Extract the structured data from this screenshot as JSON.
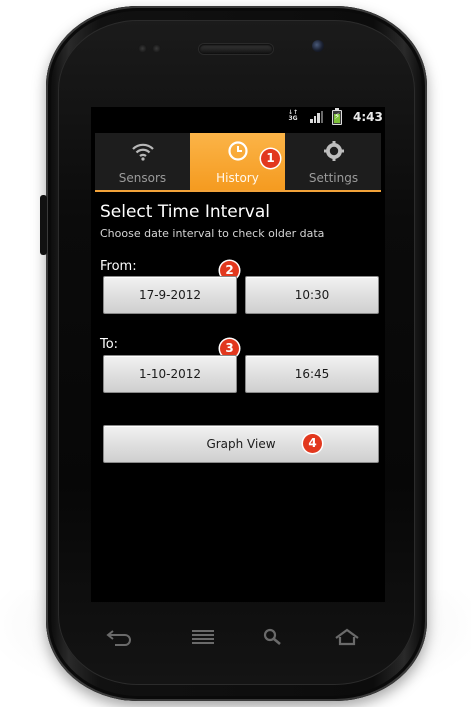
{
  "status_bar": {
    "network": "3G",
    "time": "4:43",
    "signal_bars": 3,
    "battery_charging": true
  },
  "tabs": [
    {
      "label": "Sensors",
      "icon": "wifi-icon",
      "active": false
    },
    {
      "label": "History",
      "icon": "clock-icon",
      "active": true
    },
    {
      "label": "Settings",
      "icon": "gear-icon",
      "active": false
    }
  ],
  "page": {
    "title": "Select Time Interval",
    "subtitle": "Choose date interval to check older data"
  },
  "from": {
    "label": "From:",
    "date": "17-9-2012",
    "time": "10:30"
  },
  "to": {
    "label": "To:",
    "date": "1-10-2012",
    "time": "16:45"
  },
  "graph_button_label": "Graph View",
  "annotations": [
    "1",
    "2",
    "3",
    "4"
  ],
  "nav_keys": [
    "back-icon",
    "menu-icon",
    "search-icon",
    "home-icon"
  ],
  "colors": {
    "accent": "#f59b20",
    "badge": "#e2381e",
    "tab_bg": "#1d1d1d"
  }
}
